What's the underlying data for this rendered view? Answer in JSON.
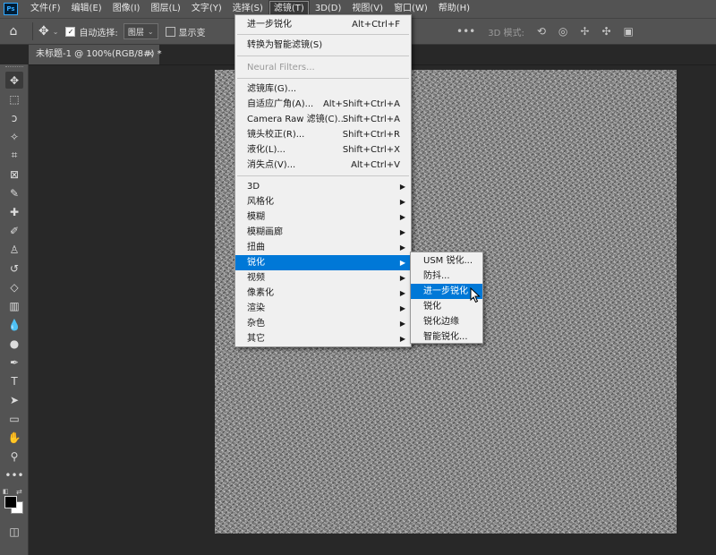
{
  "menubar": {
    "logo": "Ps",
    "items": [
      "文件(F)",
      "编辑(E)",
      "图像(I)",
      "图层(L)",
      "文字(Y)",
      "选择(S)",
      "滤镜(T)",
      "3D(D)",
      "视图(V)",
      "窗口(W)",
      "帮助(H)"
    ],
    "active_index": 6
  },
  "options": {
    "auto_select_label": "自动选择:",
    "auto_select_checked": true,
    "layer_select_value": "图层",
    "show_transform_label": "显示变",
    "mode_label": "3D 模式:"
  },
  "document_tab": {
    "title": "未标题-1 @ 100%(RGB/8#) *",
    "close": "×"
  },
  "filter_menu": {
    "items": [
      {
        "label": "进一步锐化",
        "shortcut": "Alt+Ctrl+F"
      },
      {
        "label": "转换为智能滤镜(S)"
      },
      {
        "label": "Neural Filters...",
        "disabled": true
      },
      {
        "label": "滤镜库(G)..."
      },
      {
        "label": "自适应广角(A)...",
        "shortcut": "Alt+Shift+Ctrl+A"
      },
      {
        "label": "Camera Raw 滤镜(C)...",
        "shortcut": "Shift+Ctrl+A"
      },
      {
        "label": "镜头校正(R)...",
        "shortcut": "Shift+Ctrl+R"
      },
      {
        "label": "液化(L)...",
        "shortcut": "Shift+Ctrl+X"
      },
      {
        "label": "消失点(V)...",
        "shortcut": "Alt+Ctrl+V"
      },
      {
        "label": "3D",
        "submenu": true
      },
      {
        "label": "风格化",
        "submenu": true
      },
      {
        "label": "模糊",
        "submenu": true
      },
      {
        "label": "模糊画廊",
        "submenu": true
      },
      {
        "label": "扭曲",
        "submenu": true
      },
      {
        "label": "锐化",
        "submenu": true,
        "highlighted": true
      },
      {
        "label": "视频",
        "submenu": true
      },
      {
        "label": "像素化",
        "submenu": true
      },
      {
        "label": "渲染",
        "submenu": true
      },
      {
        "label": "杂色",
        "submenu": true
      },
      {
        "label": "其它",
        "submenu": true
      }
    ]
  },
  "sharpen_submenu": {
    "items": [
      {
        "label": "USM 锐化..."
      },
      {
        "label": "防抖..."
      },
      {
        "label": "进一步锐化",
        "highlighted": true
      },
      {
        "label": "锐化"
      },
      {
        "label": "锐化边缘"
      },
      {
        "label": "智能锐化..."
      }
    ]
  },
  "icons": {
    "home": "home-icon",
    "move": "move-icon",
    "submenu_arrow": "▶",
    "tools": [
      "move-tool-icon",
      "marquee-tool-icon",
      "lasso-tool-icon",
      "magic-wand-icon",
      "crop-tool-icon",
      "frame-tool-icon",
      "eyedropper-icon",
      "healing-brush-icon",
      "brush-tool-icon",
      "clone-stamp-icon",
      "history-brush-icon",
      "eraser-icon",
      "gradient-tool-icon",
      "blur-tool-icon",
      "dodge-tool-icon",
      "pen-tool-icon",
      "type-tool-icon",
      "path-selection-icon",
      "rectangle-tool-icon",
      "hand-tool-icon",
      "zoom-tool-icon",
      "more-tools-icon"
    ]
  },
  "colors": {
    "chrome": "#535353",
    "workspace": "#282828",
    "menu_bg": "#f0f0f0",
    "highlight": "#0078d7"
  }
}
